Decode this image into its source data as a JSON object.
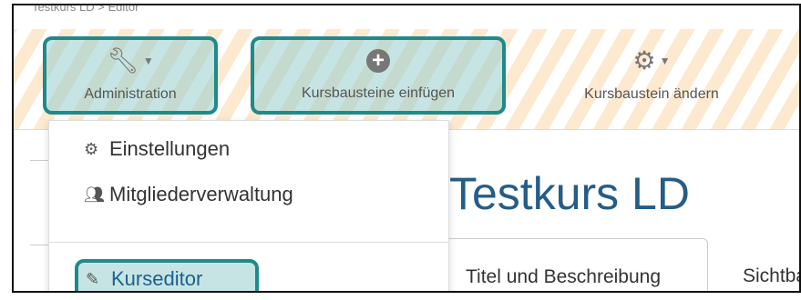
{
  "breadcrumb": "Testkurs LD > Editor",
  "toolbar": {
    "administration": "Administration",
    "insert_building_blocks": "Kursbausteine einfügen",
    "change_building_block": "Kursbaustein ändern"
  },
  "dropdown": {
    "items": [
      {
        "label": "Einstellungen",
        "icon": "cogs-icon"
      },
      {
        "label": "Mitgliederverwaltung",
        "icon": "users-icon"
      },
      {
        "label": "Kurseditor",
        "icon": "edit-icon"
      }
    ]
  },
  "course": {
    "title": "Testkurs LD"
  },
  "tabs": [
    {
      "label": "Titel und Beschreibung"
    },
    {
      "label": "Sichtbarkeit"
    }
  ],
  "colors": {
    "highlight_border": "#1e8a8a",
    "title_blue": "#245d88"
  }
}
